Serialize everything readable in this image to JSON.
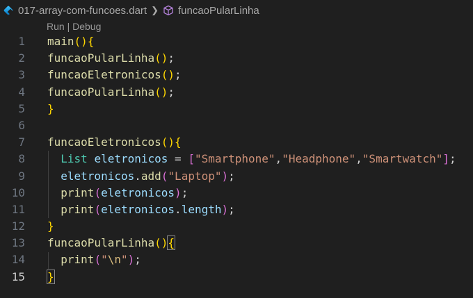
{
  "breadcrumb": {
    "file": "017-array-com-funcoes.dart",
    "symbol": "funcaoPularLinha",
    "file_icon": "dart-file-icon",
    "symbol_icon": "cube-icon"
  },
  "codelens": {
    "run": "Run",
    "sep": " | ",
    "debug": "Debug"
  },
  "editor": {
    "active_line": 15,
    "line_numbers": [
      "1",
      "2",
      "3",
      "4",
      "5",
      "6",
      "7",
      "8",
      "9",
      "10",
      "11",
      "12",
      "13",
      "14",
      "15"
    ],
    "lines": [
      [
        {
          "t": "main",
          "c": "f"
        },
        {
          "t": "()",
          "c": "p1"
        },
        {
          "t": "{",
          "c": "p1"
        }
      ],
      [
        {
          "t": "funcaoPularLinha",
          "c": "f"
        },
        {
          "t": "()",
          "c": "p1"
        },
        {
          "t": ";",
          "c": "op"
        }
      ],
      [
        {
          "t": "funcaoEletronicos",
          "c": "f"
        },
        {
          "t": "()",
          "c": "p1"
        },
        {
          "t": ";",
          "c": "op"
        }
      ],
      [
        {
          "t": "funcaoPularLinha",
          "c": "f"
        },
        {
          "t": "()",
          "c": "p1"
        },
        {
          "t": ";",
          "c": "op"
        }
      ],
      [
        {
          "t": "}",
          "c": "p1"
        }
      ],
      [],
      [
        {
          "t": "funcaoEletronicos",
          "c": "f"
        },
        {
          "t": "()",
          "c": "p1"
        },
        {
          "t": "{",
          "c": "p1"
        }
      ],
      [
        {
          "t": "  ",
          "c": "op"
        },
        {
          "t": "List",
          "c": "kw"
        },
        {
          "t": " ",
          "c": "op"
        },
        {
          "t": "eletronicos",
          "c": "var"
        },
        {
          "t": " = ",
          "c": "op"
        },
        {
          "t": "[",
          "c": "p2"
        },
        {
          "t": "\"Smartphone\"",
          "c": "str"
        },
        {
          "t": ",",
          "c": "op"
        },
        {
          "t": "\"Headphone\"",
          "c": "str"
        },
        {
          "t": ",",
          "c": "op"
        },
        {
          "t": "\"Smartwatch\"",
          "c": "str"
        },
        {
          "t": "]",
          "c": "p2"
        },
        {
          "t": ";",
          "c": "op"
        }
      ],
      [
        {
          "t": "  ",
          "c": "op"
        },
        {
          "t": "eletronicos",
          "c": "var"
        },
        {
          "t": ".",
          "c": "op"
        },
        {
          "t": "add",
          "c": "f"
        },
        {
          "t": "(",
          "c": "p2"
        },
        {
          "t": "\"Laptop\"",
          "c": "str"
        },
        {
          "t": ")",
          "c": "p2"
        },
        {
          "t": ";",
          "c": "op"
        }
      ],
      [
        {
          "t": "  ",
          "c": "op"
        },
        {
          "t": "print",
          "c": "f"
        },
        {
          "t": "(",
          "c": "p2"
        },
        {
          "t": "eletronicos",
          "c": "var"
        },
        {
          "t": ")",
          "c": "p2"
        },
        {
          "t": ";",
          "c": "op"
        }
      ],
      [
        {
          "t": "  ",
          "c": "op"
        },
        {
          "t": "print",
          "c": "f"
        },
        {
          "t": "(",
          "c": "p2"
        },
        {
          "t": "eletronicos",
          "c": "var"
        },
        {
          "t": ".",
          "c": "op"
        },
        {
          "t": "length",
          "c": "var"
        },
        {
          "t": ")",
          "c": "p2"
        },
        {
          "t": ";",
          "c": "op"
        }
      ],
      [
        {
          "t": "}",
          "c": "p1"
        }
      ],
      [
        {
          "t": "funcaoPularLinha",
          "c": "f"
        },
        {
          "t": "()",
          "c": "p1"
        },
        {
          "t": "{",
          "c": "p1 bm"
        }
      ],
      [
        {
          "t": "  ",
          "c": "op"
        },
        {
          "t": "print",
          "c": "f"
        },
        {
          "t": "(",
          "c": "p2"
        },
        {
          "t": "\"",
          "c": "str"
        },
        {
          "t": "\\n",
          "c": "esc"
        },
        {
          "t": "\"",
          "c": "str"
        },
        {
          "t": ")",
          "c": "p2"
        },
        {
          "t": ";",
          "c": "op"
        }
      ],
      [
        {
          "t": "}",
          "c": "p1 bm"
        }
      ]
    ]
  }
}
